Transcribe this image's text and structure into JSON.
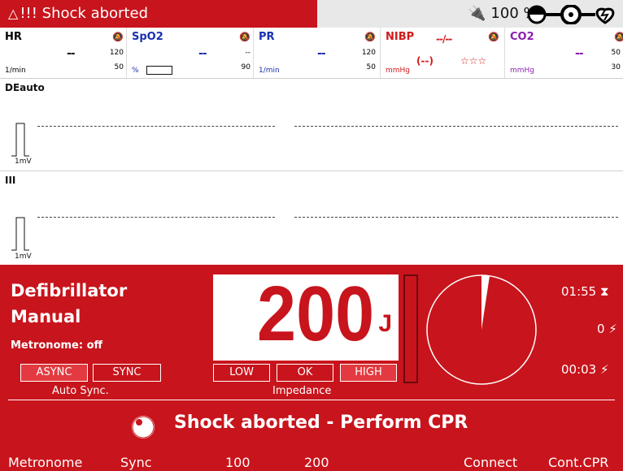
{
  "alarm": {
    "warning_glyph": "△",
    "text": "!!! Shock aborted"
  },
  "status": {
    "plug_glyph": "⧳",
    "battery": "100 %"
  },
  "params": {
    "hr": {
      "label": "HR",
      "value": "--",
      "unit": "1/min",
      "upper": "120",
      "lower": "50",
      "color": "#111111"
    },
    "spo2": {
      "label": "SpO2",
      "value": "--",
      "unit": "%",
      "upper": "--",
      "lower": "90",
      "color": "#1a2fb0"
    },
    "pr": {
      "label": "PR",
      "value": "--",
      "unit": "1/min",
      "upper": "120",
      "lower": "50",
      "color": "#1a2fb0"
    },
    "nibp": {
      "label": "NIBP",
      "value": "--/--",
      "mean": "(--)",
      "stars": "☆☆☆",
      "unit": "mmHg",
      "color": "#d21a1a"
    },
    "co2": {
      "label": "CO2",
      "value": "--",
      "unit": "mmHg",
      "upper": "50",
      "lower": "30",
      "color": "#8a1fb0"
    },
    "bell_glyph": "🔕"
  },
  "waves": [
    {
      "label": "DEauto",
      "scale": "1mV"
    },
    {
      "label": "III",
      "scale": "1mV"
    }
  ],
  "defib": {
    "title1": "Defibrillator",
    "title2": "Manual",
    "metronome": "Metronome: off",
    "async": "ASYNC",
    "sync": "SYNC",
    "auto_sync": "Auto Sync.",
    "energy": "200",
    "energy_unit": "J",
    "low": "LOW",
    "ok": "OK",
    "high": "HIGH",
    "impedance": "Impedance",
    "timer": "01:55 ⧗",
    "shock_count": "0 ⚡",
    "shock_time": "00:03 ⚡",
    "message": "Shock aborted - Perform CPR",
    "charge_level": 0
  },
  "softkeys": [
    "Metronome",
    "Sync",
    "100",
    "200",
    "Connect",
    "Cont.CPR"
  ]
}
